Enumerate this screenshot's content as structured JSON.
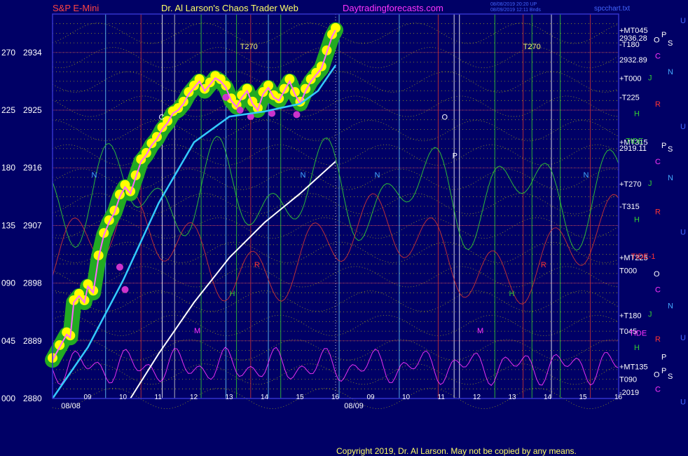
{
  "header": {
    "symbol": "S&P E-Mini",
    "site_title": "Dr. Al Larson's Chaos Trader Web",
    "url": "Daytradingforecasts.com",
    "file_label": "spcchart.txt",
    "timestamp_1": "08/08/2019 20:20 UP",
    "timestamp_2": "08/09/2019 12:11 Bnds"
  },
  "footer": {
    "copyright": "Copyright 2019, Dr. Al Larson. May not be copied by any means."
  },
  "colors": {
    "background": "#000066",
    "price_area": "#ffff00",
    "price_glow": "#22aa22",
    "price_line": "#ff66ff",
    "ema_fast": "#33ccff",
    "ema_slow": "#ffffff",
    "grid_dots": "#cccc00",
    "vline_red": "#cc3333",
    "vline_cyan": "#66ccff",
    "vline_green": "#33cc33",
    "vline_white": "#ffffff",
    "border": "#3333cc"
  },
  "chart_data": {
    "type": "line",
    "title": "S&P E-Mini",
    "ylim": [
      2880,
      2940
    ],
    "y_ticks": [
      {
        "angle": "000",
        "price": "2880",
        "value": 2880
      },
      {
        "angle": "045",
        "price": "2889",
        "value": 2889
      },
      {
        "angle": "090",
        "price": "2898",
        "value": 2898
      },
      {
        "angle": "135",
        "price": "2907",
        "value": 2907
      },
      {
        "angle": "180",
        "price": "2916",
        "value": 2916
      },
      {
        "angle": "225",
        "price": "2925",
        "value": 2925
      },
      {
        "angle": "270",
        "price": "2934",
        "value": 2934
      }
    ],
    "x_hours": [
      {
        "label": "09",
        "x": 9
      },
      {
        "label": "10",
        "x": 10
      },
      {
        "label": "11",
        "x": 11
      },
      {
        "label": "12",
        "x": 12
      },
      {
        "label": "13",
        "x": 13
      },
      {
        "label": "14",
        "x": 14
      },
      {
        "label": "15",
        "x": 15
      },
      {
        "label": "16",
        "x": 16
      },
      {
        "label": "09",
        "x": 17
      },
      {
        "label": "10",
        "x": 18
      },
      {
        "label": "11",
        "x": 19
      },
      {
        "label": "12",
        "x": 20
      },
      {
        "label": "13",
        "x": 21
      },
      {
        "label": "14",
        "x": 22
      },
      {
        "label": "15",
        "x": 23
      },
      {
        "label": "16",
        "x": 24
      }
    ],
    "date_labels": [
      {
        "label": "08/08",
        "x": 8.6
      },
      {
        "label": "08/09",
        "x": 16.6
      }
    ],
    "price_series": {
      "name": "S&P E-Mini",
      "points": [
        [
          8.0,
          2886.0
        ],
        [
          8.2,
          2888.0
        ],
        [
          8.4,
          2890.0
        ],
        [
          8.5,
          2889.5
        ],
        [
          8.6,
          2895.0
        ],
        [
          8.75,
          2896.0
        ],
        [
          8.9,
          2895.0
        ],
        [
          9.0,
          2897.5
        ],
        [
          9.15,
          2896.5
        ],
        [
          9.3,
          2902.0
        ],
        [
          9.45,
          2905.5
        ],
        [
          9.6,
          2907.5
        ],
        [
          9.75,
          2909.0
        ],
        [
          9.9,
          2911.5
        ],
        [
          10.05,
          2913.0
        ],
        [
          10.2,
          2912.0
        ],
        [
          10.35,
          2914.5
        ],
        [
          10.5,
          2917.0
        ],
        [
          10.65,
          2918.0
        ],
        [
          10.8,
          2919.5
        ],
        [
          10.95,
          2920.5
        ],
        [
          11.1,
          2922.0
        ],
        [
          11.25,
          2923.0
        ],
        [
          11.4,
          2924.5
        ],
        [
          11.55,
          2925.0
        ],
        [
          11.7,
          2926.0
        ],
        [
          11.85,
          2927.5
        ],
        [
          12.0,
          2928.5
        ],
        [
          12.15,
          2929.5
        ],
        [
          12.3,
          2928.0
        ],
        [
          12.45,
          2929.0
        ],
        [
          12.6,
          2930.0
        ],
        [
          12.75,
          2929.5
        ],
        [
          12.9,
          2928.5
        ],
        [
          13.05,
          2926.5
        ],
        [
          13.2,
          2925.5
        ],
        [
          13.35,
          2927.0
        ],
        [
          13.5,
          2928.0
        ],
        [
          13.65,
          2926.0
        ],
        [
          13.8,
          2925.0
        ],
        [
          13.95,
          2927.5
        ],
        [
          14.1,
          2928.5
        ],
        [
          14.25,
          2927.0
        ],
        [
          14.4,
          2926.5
        ],
        [
          14.55,
          2928.0
        ],
        [
          14.7,
          2929.5
        ],
        [
          14.85,
          2927.5
        ],
        [
          15.0,
          2926.0
        ],
        [
          15.15,
          2928.0
        ],
        [
          15.3,
          2929.5
        ],
        [
          15.45,
          2930.5
        ],
        [
          15.6,
          2931.5
        ],
        [
          15.75,
          2934.0
        ],
        [
          15.9,
          2936.5
        ],
        [
          16.0,
          2937.5
        ]
      ]
    },
    "ema_fast": {
      "name": "fast EMA",
      "points": [
        [
          8.0,
          2880.0
        ],
        [
          9.0,
          2888.0
        ],
        [
          10.0,
          2898.5
        ],
        [
          11.0,
          2910.5
        ],
        [
          12.0,
          2920.0
        ],
        [
          13.0,
          2924.0
        ],
        [
          14.0,
          2924.8
        ],
        [
          15.0,
          2926.0
        ],
        [
          15.5,
          2928.0
        ],
        [
          16.0,
          2932.0
        ]
      ]
    },
    "ema_slow": {
      "name": "slow EMA",
      "points": [
        [
          10.2,
          2880.0
        ],
        [
          11.0,
          2887.0
        ],
        [
          12.0,
          2895.0
        ],
        [
          13.0,
          2902.0
        ],
        [
          14.0,
          2907.5
        ],
        [
          15.0,
          2912.0
        ],
        [
          16.0,
          2917.0
        ]
      ]
    },
    "vlines": [
      {
        "x": 9.5,
        "color": "#66ccff"
      },
      {
        "x": 10.5,
        "color": "#cc3333"
      },
      {
        "x": 11.1,
        "color": "#ffffff"
      },
      {
        "x": 11.45,
        "color": "#cccccc"
      },
      {
        "x": 12.2,
        "color": "#33cc33"
      },
      {
        "x": 12.9,
        "color": "#66ccff"
      },
      {
        "x": 13.2,
        "color": "#33cc33"
      },
      {
        "x": 13.6,
        "color": "#cc3333"
      },
      {
        "x": 14.1,
        "color": "#66ccff"
      },
      {
        "x": 14.45,
        "color": "#33cc33"
      },
      {
        "x": 16.1,
        "color": "#66ccff"
      },
      {
        "x": 17.8,
        "color": "#66ccff"
      },
      {
        "x": 18.9,
        "color": "#cc3333"
      },
      {
        "x": 19.35,
        "color": "#ffffff"
      },
      {
        "x": 19.5,
        "color": "#ffffff"
      },
      {
        "x": 20.5,
        "color": "#33cc33"
      },
      {
        "x": 21.3,
        "color": "#cc3333"
      },
      {
        "x": 21.55,
        "color": "#33cc33"
      },
      {
        "x": 22.1,
        "color": "#ffffff"
      },
      {
        "x": 22.35,
        "color": "#33cc33"
      },
      {
        "x": 23.2,
        "color": "#cc3333"
      }
    ],
    "level_labels": [
      {
        "text": "+MT045",
        "y": 2937.5
      },
      {
        "text": "2936.28",
        "y": 2936.3
      },
      {
        "text": "-T180",
        "y": 2935.3
      },
      {
        "text": "2932.89",
        "y": 2932.9
      },
      {
        "text": "+T000",
        "y": 2930.0
      },
      {
        "text": "-T225",
        "y": 2927.0
      },
      {
        "text": "+MT315",
        "y": 2920.0
      },
      {
        "text": "2919.11",
        "y": 2919.1
      },
      {
        "text": "+T270",
        "y": 2913.5
      },
      {
        "text": "-T315",
        "y": 2910.0
      },
      {
        "text": "+MT225",
        "y": 2902.0
      },
      {
        "text": "T000",
        "y": 2900.0
      },
      {
        "text": "+T180",
        "y": 2893.0
      },
      {
        "text": "T045",
        "y": 2890.5
      },
      {
        "text": "+MT135",
        "y": 2885.0
      },
      {
        "text": "T090",
        "y": 2883.0
      },
      {
        "text": "-2019",
        "y": 2881.0
      }
    ],
    "side_letters": [
      {
        "text": "U",
        "color": "#4466ff",
        "col": 2,
        "y": 2939.0
      },
      {
        "text": "O",
        "color": "#ffffff",
        "col": 0,
        "y": 2936.0
      },
      {
        "text": "P",
        "color": "#ffffff",
        "col": 1,
        "y": 2936.8
      },
      {
        "text": "S",
        "color": "#ffffff",
        "col": 1.6,
        "y": 2935.5
      },
      {
        "text": "C",
        "color": "#ff33ff",
        "col": 0.4,
        "y": 2933.5
      },
      {
        "text": "N",
        "color": "#44aaff",
        "col": 1.6,
        "y": 2931.0
      },
      {
        "text": "J",
        "color": "#33cc33",
        "col": 0.2,
        "y": 2930.1
      },
      {
        "text": "R",
        "color": "#ff3333",
        "col": 0.4,
        "y": 2926.0
      },
      {
        "text": "H",
        "color": "#33cc33",
        "col": 0.1,
        "y": 2924.5
      },
      {
        "text": "U",
        "color": "#4466ff",
        "col": 2,
        "y": 2922.5
      },
      {
        "text": "P",
        "color": "#ffffff",
        "col": 1,
        "y": 2919.5
      },
      {
        "text": "S",
        "color": "#ffffff",
        "col": 1.6,
        "y": 2919.0
      },
      {
        "text": "C",
        "color": "#ff33ff",
        "col": 0.4,
        "y": 2917.0
      },
      {
        "text": "N",
        "color": "#44aaff",
        "col": 1.6,
        "y": 2914.5
      },
      {
        "text": "J",
        "color": "#33cc33",
        "col": 0.2,
        "y": 2913.6
      },
      {
        "text": "R",
        "color": "#ff3333",
        "col": 0.4,
        "y": 2909.2
      },
      {
        "text": "H",
        "color": "#33cc33",
        "col": 0.1,
        "y": 2908.0
      },
      {
        "text": "U",
        "color": "#4466ff",
        "col": 2,
        "y": 2906.0
      },
      {
        "text": "O",
        "color": "#ffffff",
        "col": 0,
        "y": 2899.5
      },
      {
        "text": "C",
        "color": "#ff33ff",
        "col": 0.4,
        "y": 2897.0
      },
      {
        "text": "N",
        "color": "#44aaff",
        "col": 1.6,
        "y": 2894.5
      },
      {
        "text": "J",
        "color": "#33cc33",
        "col": 0.2,
        "y": 2893.2
      },
      {
        "text": "U",
        "color": "#4466ff",
        "col": 2,
        "y": 2889.5
      },
      {
        "text": "R",
        "color": "#ff3333",
        "col": 0.4,
        "y": 2889.3
      },
      {
        "text": "H",
        "color": "#33cc33",
        "col": 0.1,
        "y": 2888.0
      },
      {
        "text": "P",
        "color": "#ffffff",
        "col": 1,
        "y": 2886.5
      },
      {
        "text": "O",
        "color": "#ffffff",
        "col": 0,
        "y": 2883.8
      },
      {
        "text": "P",
        "color": "#ffffff",
        "col": 1,
        "y": 2884.4
      },
      {
        "text": "S",
        "color": "#ffffff",
        "col": 1.6,
        "y": 2883.5
      },
      {
        "text": "C",
        "color": "#ff33ff",
        "col": 0.4,
        "y": 2881.5
      },
      {
        "text": "U",
        "color": "#4466ff",
        "col": 2,
        "y": 2879.5
      }
    ],
    "annotations": [
      {
        "text": "T270",
        "x": 13.3,
        "y": 2934.5,
        "color": "#ffff66"
      },
      {
        "text": "T270",
        "x": 21.3,
        "y": 2934.5,
        "color": "#ffff66"
      },
      {
        "text": "C",
        "x": 11.0,
        "y": 2923.5,
        "color": "#ffffff"
      },
      {
        "text": "O",
        "x": 19.0,
        "y": 2923.5,
        "color": "#ffffff"
      },
      {
        "text": "N",
        "x": 9.1,
        "y": 2914.5,
        "color": "#44aaff"
      },
      {
        "text": "N",
        "x": 15.0,
        "y": 2914.5,
        "color": "#44aaff"
      },
      {
        "text": "N",
        "x": 17.1,
        "y": 2914.5,
        "color": "#44aaff"
      },
      {
        "text": "N",
        "x": 23.0,
        "y": 2914.5,
        "color": "#44aaff"
      },
      {
        "text": "P",
        "x": 19.3,
        "y": 2917.5,
        "color": "#ffffff"
      },
      {
        "text": "TIDE",
        "x": 24.2,
        "y": 2919.8,
        "color": "#33cc33"
      },
      {
        "text": "TIDE-1",
        "x": 24.35,
        "y": 2901.8,
        "color": "#ff3333"
      },
      {
        "text": "TIDE",
        "x": 24.3,
        "y": 2889.8,
        "color": "#ff33ff"
      },
      {
        "text": "H",
        "x": 13.0,
        "y": 2896.0,
        "color": "#33cc33"
      },
      {
        "text": "H",
        "x": 20.9,
        "y": 2896.0,
        "color": "#33cc33"
      },
      {
        "text": "M",
        "x": 12.0,
        "y": 2890.2,
        "color": "#ff33ff"
      },
      {
        "text": "M",
        "x": 20.0,
        "y": 2890.2,
        "color": "#ff33ff"
      },
      {
        "text": "R",
        "x": 13.7,
        "y": 2900.5,
        "color": "#ff3333"
      },
      {
        "text": "R",
        "x": 21.8,
        "y": 2900.5,
        "color": "#ff3333"
      }
    ]
  }
}
